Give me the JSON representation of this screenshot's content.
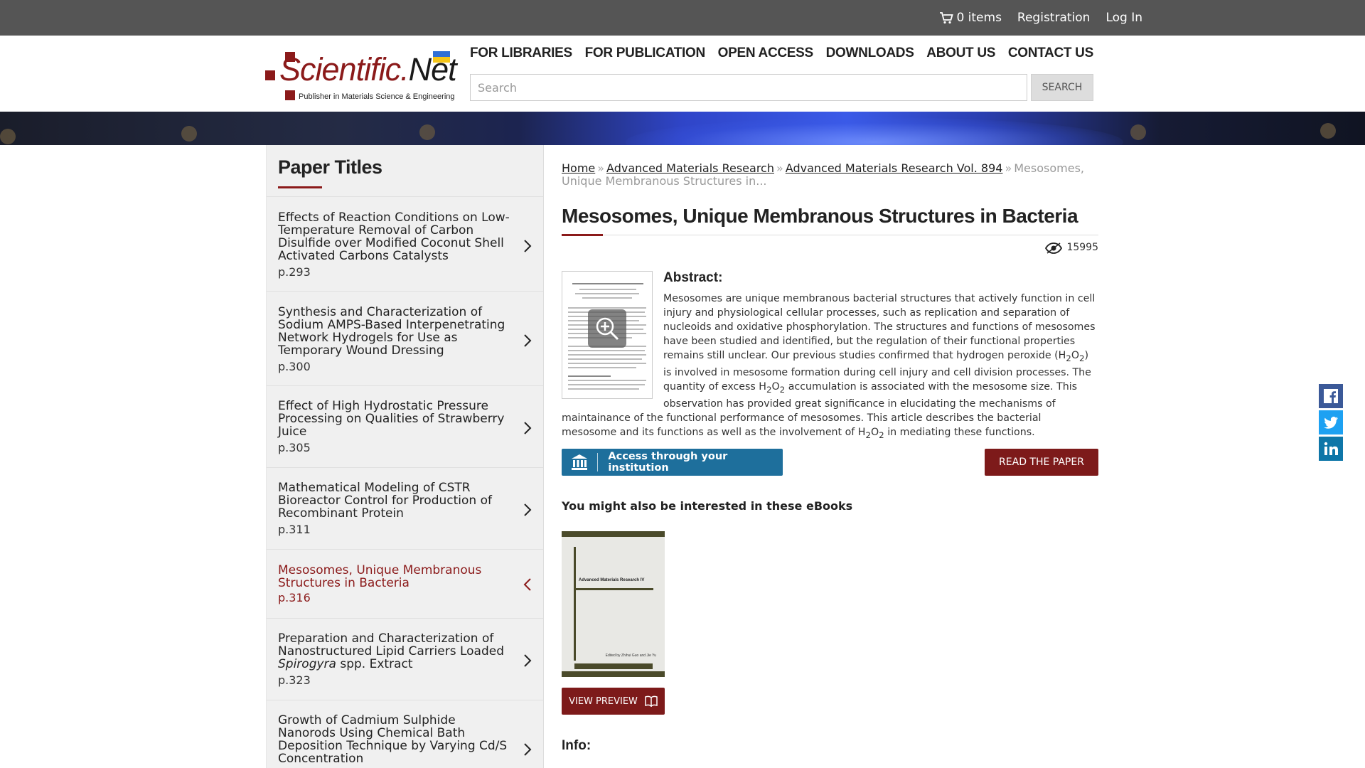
{
  "topbar": {
    "cart": "0 items",
    "registration": "Registration",
    "login": "Log In"
  },
  "logo": {
    "text_main": "Scientific",
    "text_dot": ".",
    "text_net": "Net",
    "subtitle": "Publisher in Materials Science & Engineering"
  },
  "nav": [
    "FOR LIBRARIES",
    "FOR PUBLICATION",
    "OPEN ACCESS",
    "DOWNLOADS",
    "ABOUT US",
    "CONTACT US"
  ],
  "search": {
    "placeholder": "Search",
    "button": "SEARCH"
  },
  "sidebar": {
    "title": "Paper Titles",
    "items": [
      {
        "title": "Effects of Reaction Conditions on Low-Temperature Removal of Carbon Disulfide over Modified Coconut Shell Activated Carbons Catalysts",
        "page": "p.293"
      },
      {
        "title": "Synthesis and Characterization of Sodium AMPS-Based Interpenetrating Network Hydrogels for Use as Temporary Wound Dressing",
        "page": "p.300"
      },
      {
        "title": "Effect of High Hydrostatic Pressure Processing on Qualities of Strawberry Juice",
        "page": "p.305"
      },
      {
        "title": "Mathematical Modeling of CSTR Bioreactor Control for Production of Recombinant Protein",
        "page": "p.311"
      },
      {
        "title": "Mesosomes, Unique Membranous Structures in Bacteria",
        "page": "p.316",
        "active": true
      },
      {
        "title_pre": "Preparation and Characterization of Nanostructured Lipid Carriers Loaded ",
        "title_em": "Spirogyra",
        "title_post": " spp. Extract",
        "page": "p.323"
      },
      {
        "title": "Growth of Cadmium Sulphide Nanorods Using Chemical Bath Deposition Technique by Varying Cd/S Concentration",
        "page": ""
      }
    ]
  },
  "breadcrumb": {
    "home": "Home",
    "journal": "Advanced Materials Research",
    "volume": "Advanced Materials Research Vol. 894",
    "current": "Mesosomes, Unique Membranous Structures in..."
  },
  "paper": {
    "title": "Mesosomes, Unique Membranous Structures in Bacteria",
    "views": "15995",
    "abstract_label": "Abstract:",
    "abstract_1": "Mesosomes are unique membranous bacterial structures that actively function in cell injury and physiological cellular processes, such as replication and separation of nucleoids and oxidative phosphorylation. The structures and functions of mesosomes have been studied and identified, but the regulation of their functional properties remains still unclear. Our previous studies confirmed that hydrogen peroxide (H",
    "abstract_2": "O",
    "abstract_3": ") is involved in mesosome formation during cell injury and cell division processes. The quantity of excess H",
    "abstract_4": "O",
    "abstract_5": " accumulation is associated with the mesosome size. This observation has provided great significance in elucidating the mechanisms of maintainance of the functional performance of mesosomes. This article describes the bacterial mesosome and its functions as well as the involvement of H",
    "abstract_6": "O",
    "abstract_7": " in mediating these functions.",
    "sub2": "2",
    "access_button": "Access through your institution",
    "read_button": "READ THE PAPER"
  },
  "ebooks": {
    "heading": "You might also be interested in these eBooks",
    "book_title": "Advanced Materials Research IV",
    "book_editors": "Edited by\nZhihui Guo and Jie Yu",
    "preview_button": "VIEW PREVIEW"
  },
  "info_label": "Info:",
  "social": [
    "facebook-icon",
    "twitter-icon",
    "linkedin-icon"
  ],
  "colors": {
    "brand": "#8b1a1a",
    "access": "#1e6f9c",
    "topbar": "#555555"
  }
}
